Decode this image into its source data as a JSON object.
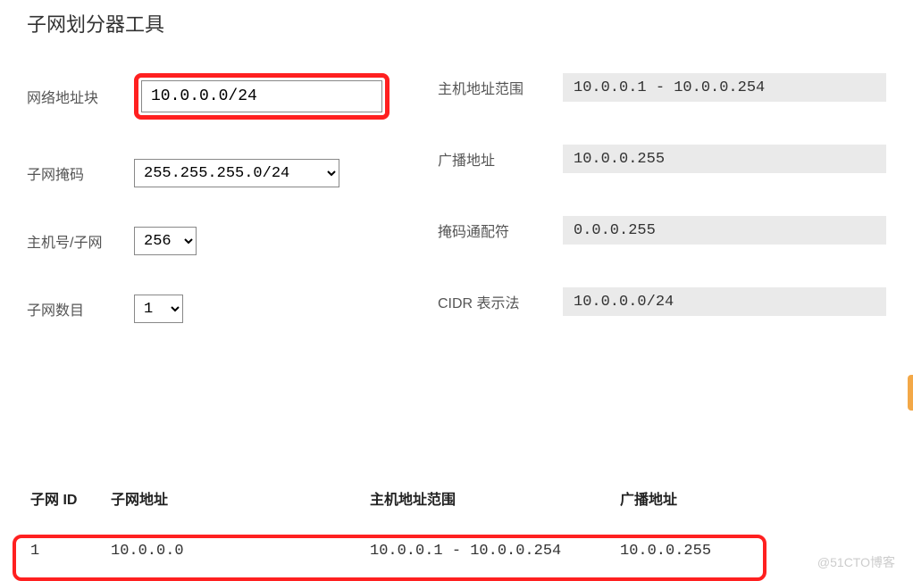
{
  "title": "子网划分器工具",
  "left": {
    "network_block": {
      "label": "网络地址块",
      "value": "10.0.0.0/24"
    },
    "subnet_mask": {
      "label": "子网掩码",
      "value": "255.255.255.0/24"
    },
    "hosts_per_subnet": {
      "label": "主机号/子网",
      "value": "256"
    },
    "subnet_count": {
      "label": "子网数目",
      "value": "1"
    }
  },
  "right": {
    "host_range": {
      "label": "主机地址范围",
      "value": "10.0.0.1 - 10.0.0.254"
    },
    "broadcast": {
      "label": "广播地址",
      "value": "10.0.0.255"
    },
    "wildcard": {
      "label": "掩码通配符",
      "value": "0.0.0.255"
    },
    "cidr": {
      "label": "CIDR 表示法",
      "value": "10.0.0.0/24"
    }
  },
  "table": {
    "headers": {
      "id": "子网 ID",
      "address": "子网地址",
      "range": "主机地址范围",
      "broadcast": "广播地址"
    },
    "row": {
      "id": "1",
      "address": "10.0.0.0",
      "range": "10.0.0.1 - 10.0.0.254",
      "broadcast": "10.0.0.255"
    }
  },
  "watermark": "@51CTO博客"
}
